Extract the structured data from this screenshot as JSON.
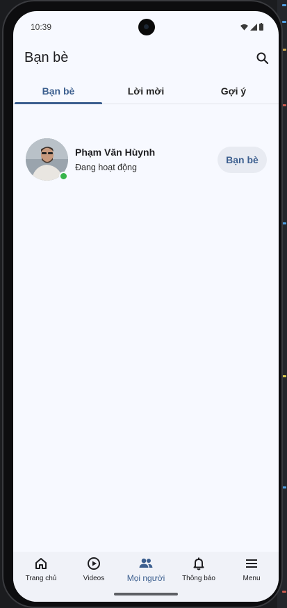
{
  "status_bar": {
    "time": "10:39"
  },
  "app_bar": {
    "title": "Bạn bè",
    "search_icon": "search-icon"
  },
  "tabs": [
    {
      "label": "Bạn bè",
      "active": true
    },
    {
      "label": "Lời mời",
      "active": false
    },
    {
      "label": "Gợi ý",
      "active": false
    }
  ],
  "friends": [
    {
      "name": "Phạm Văn Hùynh",
      "status": "Đang hoạt động",
      "online": true,
      "action_label": "Bạn bè"
    }
  ],
  "bottom_nav": [
    {
      "label": "Trang chủ",
      "icon": "home-icon",
      "active": false
    },
    {
      "label": "Videos",
      "icon": "play-circle-icon",
      "active": false
    },
    {
      "label": "Mọi người",
      "icon": "people-icon",
      "active": true
    },
    {
      "label": "Thông báo",
      "icon": "bell-icon",
      "active": false
    },
    {
      "label": "Menu",
      "icon": "menu-icon",
      "active": false
    }
  ],
  "colors": {
    "accent": "#3c5f8f",
    "background": "#f7f9ff",
    "online": "#36b44a",
    "nav_background": "#f0f2f8"
  }
}
